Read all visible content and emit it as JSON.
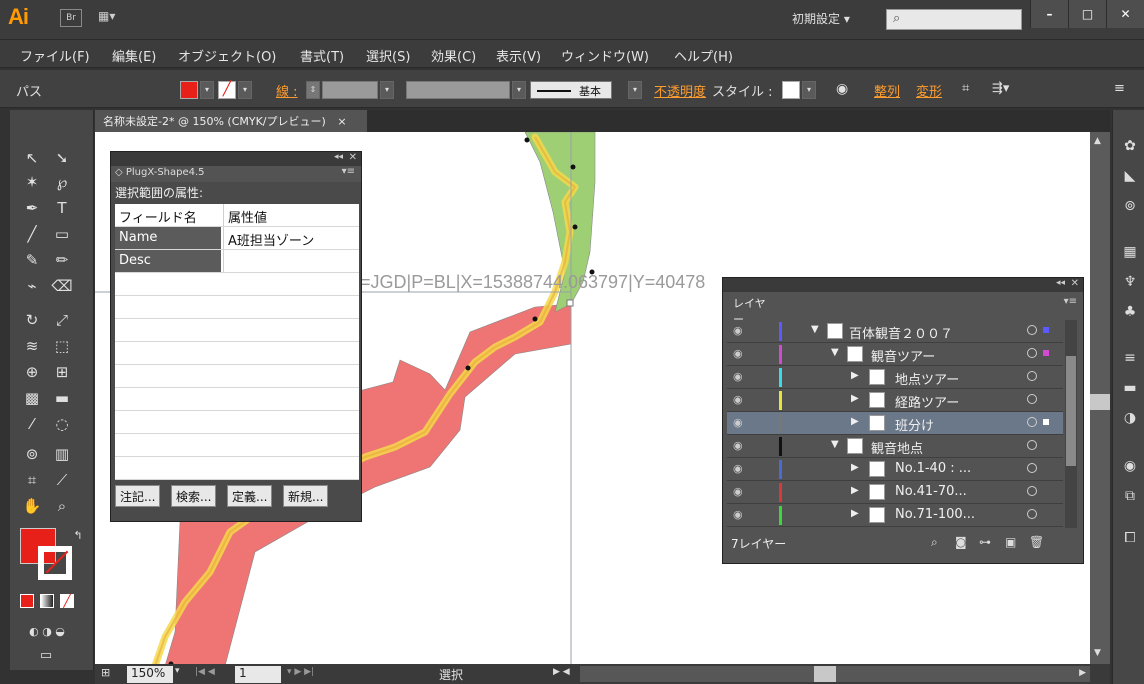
{
  "app": {
    "logo": "Ai",
    "bridge": "Br",
    "workspace": "初期設定 ▾"
  },
  "menu": [
    "ファイル(F)",
    "編集(E)",
    "オブジェクト(O)",
    "書式(T)",
    "選択(S)",
    "効果(C)",
    "表示(V)",
    "ウィンドウ(W)",
    "ヘルプ(H)"
  ],
  "control": {
    "path_label": "パス",
    "stroke_label": "線 :",
    "basic_label": "基本",
    "opacity_label": "不透明度",
    "style_label": "スタイル :",
    "align_label": "整列",
    "transform_label": "変形",
    "fill_color": "#e8201a"
  },
  "document": {
    "tab_title": "名称未設定-2* @ 150% (CMYK/プレビュー)",
    "tab_close": "×"
  },
  "canvas": {
    "coord_text": "=JGD|P=BL|X=15388744.063797|Y=40478"
  },
  "plugx": {
    "title": "◇ PlugX-Shape4.5",
    "section_title": "選択範囲の属性:",
    "header": {
      "field": "フィールド名",
      "value": "属性値"
    },
    "rows": [
      {
        "field": "Name",
        "value": "A班担当ゾーン"
      },
      {
        "field": "Desc",
        "value": ""
      }
    ],
    "buttons": [
      "注記...",
      "検索...",
      "定義...",
      "新規..."
    ]
  },
  "layers": {
    "tab_label": "レイヤー",
    "count_label": "7レイヤー",
    "items": [
      {
        "name": "百体観音２００７",
        "color": "#5a5aff",
        "expanded": true,
        "level": 0
      },
      {
        "name": "観音ツアー",
        "color": "#d24ad2",
        "expanded": true,
        "level": 1
      },
      {
        "name": "地点ツアー",
        "color": "#3adbe6",
        "expanded": false,
        "level": 2
      },
      {
        "name": "経路ツアー",
        "color": "#e6e63a",
        "expanded": false,
        "level": 2
      },
      {
        "name": "班分け",
        "color": "#777777",
        "expanded": false,
        "level": 2
      },
      {
        "name": "観音地点",
        "color": "#111111",
        "expanded": true,
        "level": 1
      },
      {
        "name": "No.1-40 : ...",
        "color": "#4a6ad8",
        "expanded": false,
        "level": 2
      },
      {
        "name": "No.41-70...",
        "color": "#d83a3a",
        "expanded": false,
        "level": 2
      },
      {
        "name": "No.71-100...",
        "color": "#3ad83a",
        "expanded": false,
        "level": 2
      }
    ]
  },
  "status": {
    "zoom": "150%",
    "page": "1",
    "tool": "選択"
  }
}
